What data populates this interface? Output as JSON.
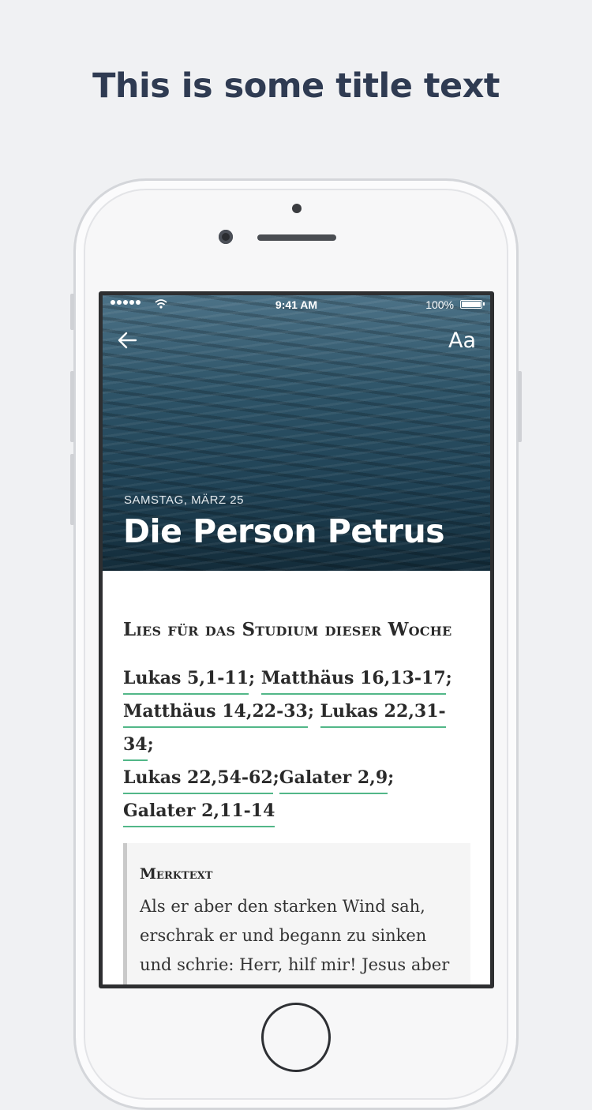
{
  "headline": "This is some title text",
  "status_bar": {
    "time": "9:41 AM",
    "battery": "100%"
  },
  "header": {
    "date": "SAMSTAG, MÄRZ 25",
    "title": "Die Person Petrus",
    "font_button": "Aa"
  },
  "content": {
    "section_title": "Lies für das Studium dieser Woche",
    "references": [
      "Lukas 5,1-11",
      "Matthäus 16,13-17",
      "Matthäus 14,22-33",
      "Lukas 22,31-34",
      "Lukas 22,54-62",
      "Galater 2,9",
      "Galater 2,11-14"
    ],
    "memory_title": "Merktext",
    "memory_text": "Als er aber den starken Wind sah, erschrak er und begann zu sinken und schrie: Herr, hilf mir! Jesus aber streckte sogleich die Hand"
  },
  "colors": {
    "link_underline": "#52b788",
    "headline": "#2f3b52"
  }
}
